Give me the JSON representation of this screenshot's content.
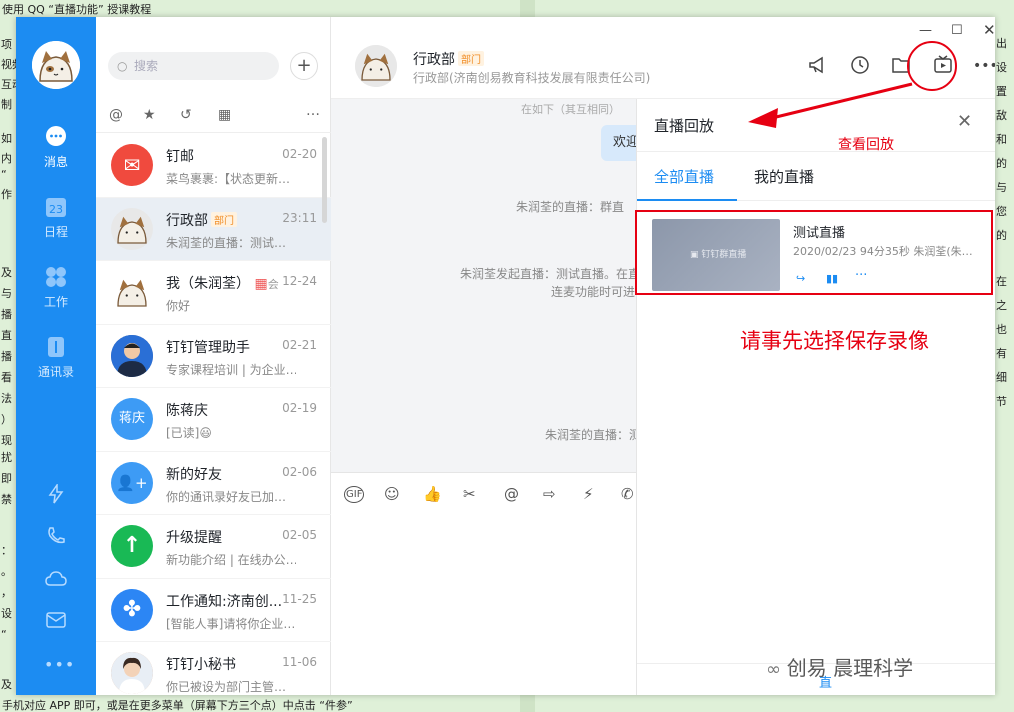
{
  "background_doc": {
    "top_line": "使用 QQ “直播功能” 授课教程",
    "bottom_line": "手机对应 APP 即可，或是在更多菜单（屏幕下方三个点）中点击 “件参”",
    "left_margin_fragments": [
      "项",
      "视频",
      "互动",
      "制"
    ],
    "left_mid_fragments": [
      "如",
      "内",
      "“",
      "作"
    ],
    "left_lower_fragments": [
      "及",
      "与",
      "播",
      "直",
      "播",
      "看",
      "法",
      "）",
      "现"
    ],
    "left_bottom_fragments": [
      "扰",
      "即",
      "禁"
    ],
    "left_foot_fragments": [
      "：",
      "。",
      "，",
      "设",
      "“"
    ],
    "left_last": "及",
    "right_margin_fragments": [
      "出",
      "设置",
      "敌和",
      "的",
      "与",
      "您的"
    ],
    "right_lower_fragments": [
      "在之",
      "也有",
      "细节"
    ]
  },
  "nav": {
    "items": [
      {
        "label": "消息",
        "icon": "chat-bubble-icon"
      },
      {
        "label": "日程",
        "icon": "calendar-icon"
      },
      {
        "label": "工作",
        "icon": "apps-grid-icon"
      },
      {
        "label": "通讯录",
        "icon": "contacts-icon"
      }
    ],
    "calendar_day": "23",
    "bottom_icons": [
      "lightning-icon",
      "phone-icon",
      "cloud-icon",
      "mail-icon",
      "more-dots-icon"
    ]
  },
  "list": {
    "search_placeholder": "搜索",
    "add_label": "+",
    "conversations": [
      {
        "name": "钉邮",
        "time": "02-20",
        "preview": "菜鸟裹裹:【状态更新…",
        "avatar_text": "✉",
        "avatar_color": "#f04a3e"
      },
      {
        "name": "行政部",
        "tag": "部门",
        "time": "23:11",
        "preview": "朱润荃的直播：测试…",
        "avatar_text": "",
        "avatar_color": "#e8e8e8"
      },
      {
        "name": "我（朱润荃）",
        "tag2": "会",
        "time": "12-24",
        "preview": "你好",
        "avatar_text": "",
        "avatar_color": "#ffffff"
      },
      {
        "name": "钉钉管理助手",
        "time": "02-21",
        "preview": "专家课程培训 | 为企业…",
        "avatar_text": "",
        "avatar_color": "#3b5b8c"
      },
      {
        "name": "陈蒋庆",
        "time": "02-19",
        "preview": "[已读]😃",
        "avatar_text": "蒋庆",
        "avatar_color": "#3d9bf5"
      },
      {
        "name": "新的好友",
        "time": "02-06",
        "preview": "你的通讯录好友已加…",
        "avatar_text": "👤+",
        "avatar_color": "#3d9bf5"
      },
      {
        "name": "升级提醒",
        "time": "02-05",
        "preview": "新功能介绍 | 在线办公…",
        "avatar_text": "↑",
        "avatar_color": "#19b955"
      },
      {
        "name": "工作通知:济南创...",
        "time": "11-25",
        "preview": "[智能人事]请将你企业…",
        "avatar_text": "✤",
        "avatar_color": "#2c86f4"
      },
      {
        "name": "钉钉小秘书",
        "time": "11-06",
        "preview": "你已被设为部门主管…",
        "avatar_text": "",
        "avatar_color": "#d9a07a"
      }
    ]
  },
  "chat": {
    "title": "行政部",
    "title_tag": "部门",
    "subtitle": "行政部(济南创易教育科技发展有限责任公司)",
    "bubble_text": "欢迎",
    "system_messages": [
      "朱润荃的直播：群直",
      "朱润荃发起直播：测试直播。在直",
      "连麦功能时可进",
      "朱润荃的直播：测"
    ],
    "top_fragment": "在如下（其互相同）"
  },
  "panel": {
    "title": "直播回放",
    "tabs": [
      "全部直播",
      "我的直播"
    ],
    "active_tab": 0,
    "card": {
      "title": "测试直播",
      "meta": "2020/02/23 94分35秒 朱润荃(朱…",
      "thumb_text": "钉钉群直播"
    },
    "footer_fragment": "直"
  },
  "annotations": {
    "view_replay": "查看回放",
    "select_save": "请事先选择保存录像",
    "accent": "#e60012"
  },
  "watermark": "创易 晨理科学",
  "colors": {
    "nav_bg": "#1c8cf2",
    "accent_blue": "#1c8cf2",
    "annotation_red": "#e60012"
  }
}
